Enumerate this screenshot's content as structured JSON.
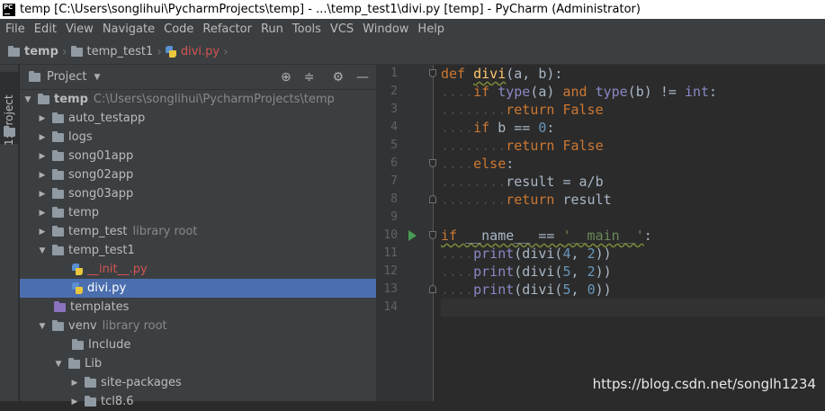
{
  "window": {
    "title": "temp [C:\\Users\\songlihui\\PycharmProjects\\temp] - ...\\temp_test1\\divi.py [temp] - PyCharm (Administrator)",
    "logo": "PC"
  },
  "menu": [
    "File",
    "Edit",
    "View",
    "Navigate",
    "Code",
    "Refactor",
    "Run",
    "Tools",
    "VCS",
    "Window",
    "Help"
  ],
  "breadcrumb": [
    "temp",
    "temp_test1",
    "divi.py"
  ],
  "left_tab": "1: Project",
  "project_panel": {
    "title": "Project",
    "tree": [
      {
        "label": "temp",
        "extra": "C:\\Users\\songlihui\\PycharmProjects\\temp"
      },
      {
        "label": "auto_testapp"
      },
      {
        "label": "logs"
      },
      {
        "label": "song01app"
      },
      {
        "label": "song02app"
      },
      {
        "label": "song03app"
      },
      {
        "label": "temp"
      },
      {
        "label": "temp_test",
        "extra": "library root"
      },
      {
        "label": "temp_test1"
      },
      {
        "label": "__init__.py"
      },
      {
        "label": "divi.py"
      },
      {
        "label": "templates"
      },
      {
        "label": "venv",
        "extra": "library root"
      },
      {
        "label": "Include"
      },
      {
        "label": "Lib"
      },
      {
        "label": "site-packages"
      },
      {
        "label": "tcl8.6"
      }
    ]
  },
  "editor": {
    "line_numbers": [
      "1",
      "2",
      "3",
      "4",
      "5",
      "6",
      "7",
      "8",
      "9",
      "10",
      "11",
      "12",
      "13",
      "14"
    ]
  },
  "watermark": "https://blog.csdn.net/songlh1234",
  "colors": {
    "selection": "#4b6eaf",
    "keyword": "#cc7832",
    "function": "#ffc66d",
    "number": "#6897bb",
    "string": "#6a8759"
  }
}
